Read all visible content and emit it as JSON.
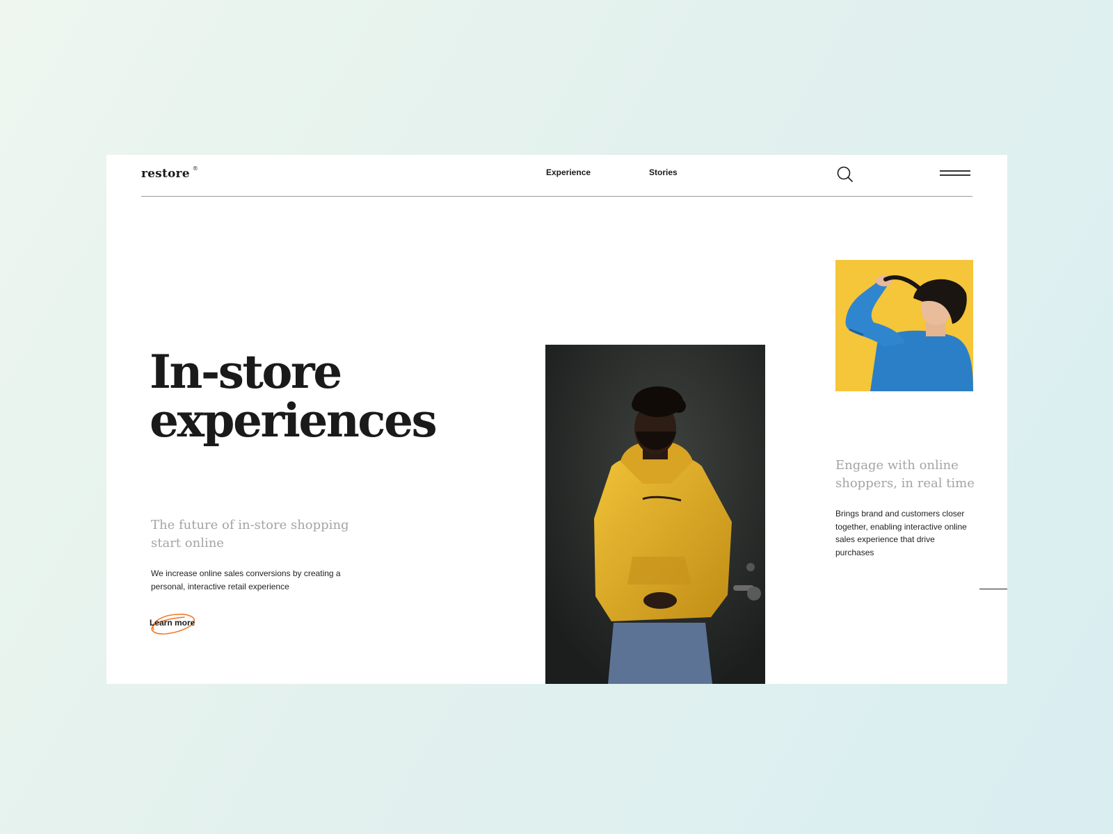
{
  "brand": {
    "name": "restore",
    "mark": "®"
  },
  "nav": {
    "items": [
      "Experience",
      "Stories"
    ]
  },
  "header": {
    "search_icon": "search-icon",
    "menu_icon": "hamburger-menu-icon"
  },
  "hero": {
    "title_lines": [
      "In-store",
      "experiences"
    ],
    "subheading": "The future of in-store shopping start online",
    "body": "We increase online sales conversions by creating a personal, interactive retail experience",
    "cta_label": "Learn more",
    "cta_accent_color": "#f07a2a"
  },
  "side": {
    "title": "Engage with online shoppers, in real time",
    "body": "Brings brand and customers closer together, enabling interactive online sales experience that drive purchases"
  },
  "images": {
    "main": "man-in-yellow-hoodie-photo",
    "secondary": "woman-denim-jacket-yellow-background-photo"
  },
  "colors": {
    "text": "#1a1a1a",
    "muted": "#a4a4a4",
    "hoodie_yellow": "#e8b52a",
    "background_yellow": "#f5c53a",
    "denim_blue": "#2b7fc6"
  }
}
